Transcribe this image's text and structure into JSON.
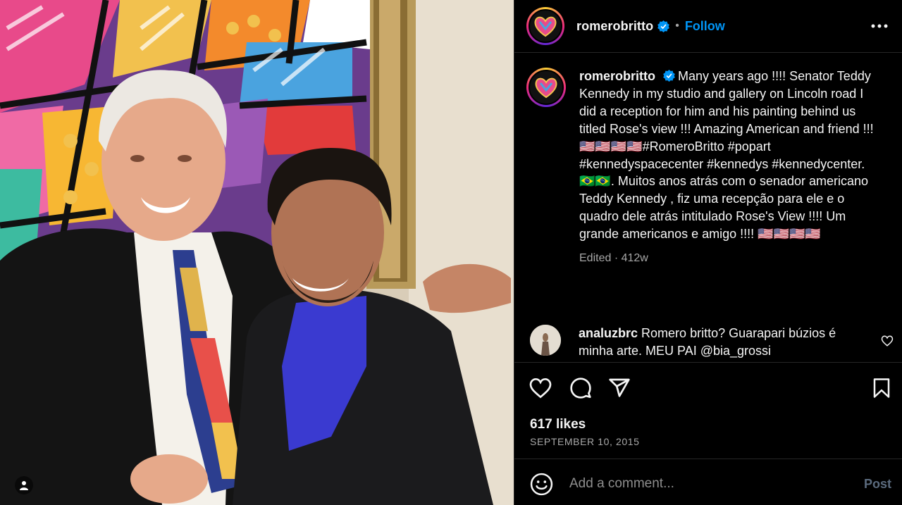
{
  "post": {
    "author": "romerobritto",
    "follow_label": "Follow",
    "separator": "•",
    "caption_user": "romerobritto",
    "caption_text": "Many years ago !!!! Senator Teddy Kennedy in my studio and gallery on Lincoln road I did a reception for him and his painting behind us titled Rose's view !!! Amazing American and friend !!!🇺🇸🇺🇸🇺🇸🇺🇸#RomeroBritto #popart #kennedyspacecenter #kennedys #kennedycenter. 🇧🇷🇧🇷. Muitos anos atrás com o senador americano Teddy Kennedy , fiz uma recepção para ele e o quadro dele atrás intitulado Rose's View !!!! Um grande americanos e amigo !!!! 🇺🇸🇺🇸🇺🇸🇺🇸",
    "caption_meta": "Edited · 412w",
    "likes": "617 likes",
    "date": "SEPTEMBER 10, 2015"
  },
  "comments": [
    {
      "user": "analuzbrc",
      "text": "Romero britto? Guarapari búzios é minha arte. MEU PAI @bia_grossi"
    }
  ],
  "comment_box": {
    "placeholder": "Add a comment...",
    "post_label": "Post"
  },
  "icons": {
    "more": "more-options-icon",
    "verified": "verified-badge-icon",
    "like": "heart-icon",
    "comment": "comment-icon",
    "share": "share-icon",
    "save": "bookmark-icon",
    "emoji": "emoji-icon",
    "user_tag": "user-tag-icon"
  },
  "colors": {
    "accent": "#0095f6",
    "background": "#000000",
    "text": "#f5f5f5",
    "muted": "#a8a8a8",
    "divider": "#262626"
  }
}
